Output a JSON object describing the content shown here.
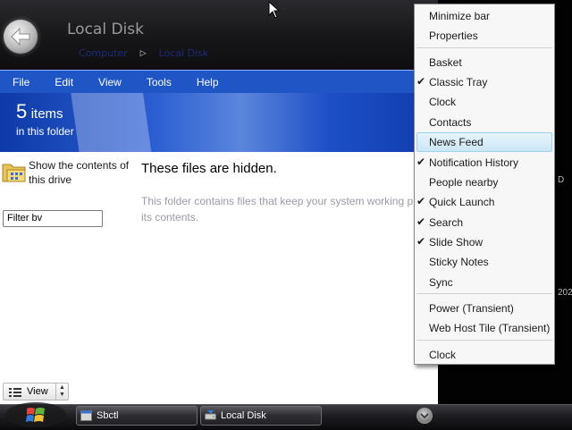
{
  "window": {
    "title": "Local Disk",
    "breadcrumbs": [
      "Computer",
      "Local Disk"
    ]
  },
  "menubar": {
    "items": [
      "File",
      "Edit",
      "View",
      "Tools",
      "Help"
    ]
  },
  "header": {
    "count": "5",
    "count_word": "items",
    "subtitle": "in this folder"
  },
  "sidebar_task": {
    "label": "Show the contents of this drive"
  },
  "filter": {
    "value": "Filter bv"
  },
  "main": {
    "title": "These files are hidden.",
    "description_line1": "This folder contains files that keep your system working p",
    "description_line2": "its contents."
  },
  "view_control": {
    "label": "View"
  },
  "taskbar": {
    "buttons": [
      {
        "label": "Sbctl"
      },
      {
        "label": "Local Disk"
      }
    ]
  },
  "right_edge": {
    "partial_text_1": "D",
    "partial_text_2": "202"
  },
  "context_menu": {
    "group1": [
      {
        "label": "Minimize bar",
        "checked": false
      },
      {
        "label": "Properties",
        "checked": false
      }
    ],
    "group2": [
      {
        "label": "Basket",
        "checked": false
      },
      {
        "label": "Classic Tray",
        "checked": true
      },
      {
        "label": "Clock",
        "checked": false
      },
      {
        "label": "Contacts",
        "checked": false
      },
      {
        "label": "News Feed",
        "checked": false,
        "highlighted": true
      },
      {
        "label": "Notification History",
        "checked": true
      },
      {
        "label": "People nearby",
        "checked": false
      },
      {
        "label": "Quick Launch",
        "checked": true
      },
      {
        "label": "Search",
        "checked": true
      },
      {
        "label": "Slide Show",
        "checked": true
      },
      {
        "label": "Sticky Notes",
        "checked": false
      },
      {
        "label": "Sync",
        "checked": false
      }
    ],
    "group3": [
      {
        "label": "Power (Transient)",
        "checked": false
      },
      {
        "label": "Web Host Tile (Transient)",
        "checked": false
      }
    ],
    "group4": [
      {
        "label": "Clock",
        "checked": false
      }
    ],
    "check_glyph": "✔"
  },
  "colors": {
    "menubar": "#1f55c4",
    "header_band": "#2b5ed1",
    "menu_highlight": "#cce7f6"
  }
}
